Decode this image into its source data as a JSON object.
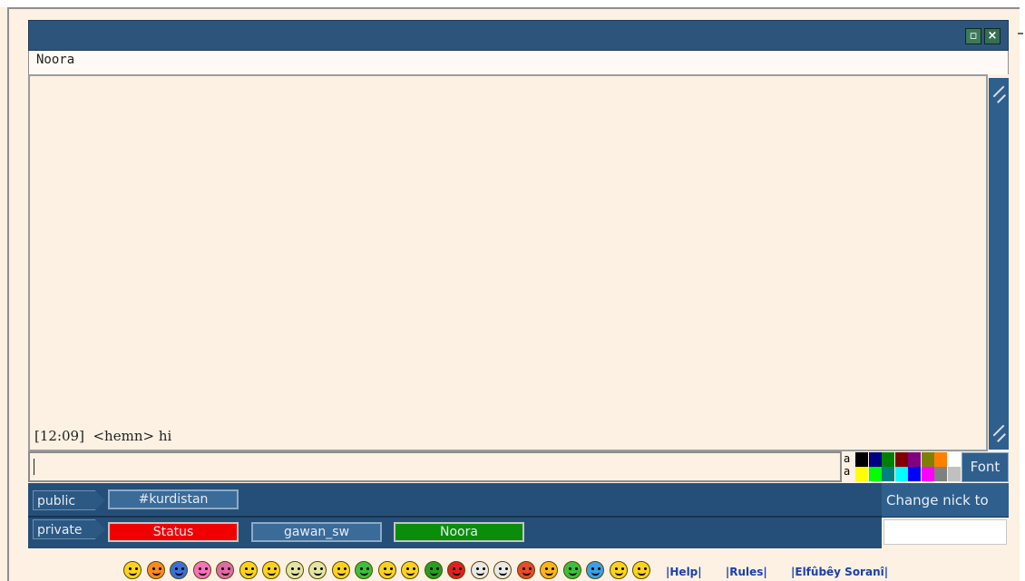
{
  "window": {
    "restore_icon": "restore-window-icon",
    "close_icon": "close-window-icon"
  },
  "nick_header": "Noora",
  "chat": {
    "messages": [
      {
        "time": "[12:09]",
        "nick": "<hemn>",
        "text": "hi"
      }
    ]
  },
  "input": {
    "value": "",
    "placeholder": ""
  },
  "color_palette": {
    "row1": [
      "#000000",
      "#000080",
      "#008000",
      "#800000",
      "#800080",
      "#808000",
      "#ff8000",
      "#ffffff"
    ],
    "row2": [
      "#ffff00",
      "#00ff00",
      "#008080",
      "#00ffff",
      "#0000ff",
      "#ff00ff",
      "#808080",
      "#c0c0c0"
    ]
  },
  "font_button": "Font",
  "channel_bar": {
    "public_label": "public",
    "private_label": "private",
    "public_tabs": [
      {
        "label": "#kurdistan",
        "color": "#3a6b99"
      }
    ],
    "private_tabs": [
      {
        "label": "Status",
        "color": "#f00000"
      },
      {
        "label": "gawan_sw",
        "color": "#3a6b99"
      },
      {
        "label": "Noora",
        "color": "#0a8d0a"
      }
    ]
  },
  "nick_change": {
    "button_label": "Change nick to",
    "input_value": ""
  },
  "smileys": [
    {
      "name": "smile-icon",
      "color": "#ffd21f"
    },
    {
      "name": "angry-icon",
      "color": "#ff8a1f"
    },
    {
      "name": "sad-blue-icon",
      "color": "#3b6fd8"
    },
    {
      "name": "shocked-icon",
      "color": "#ff70c0"
    },
    {
      "name": "tongue-icon",
      "color": "#e06aa8"
    },
    {
      "name": "confused-icon",
      "color": "#ffd21f"
    },
    {
      "name": "glasses-icon",
      "color": "#ffd21f"
    },
    {
      "name": "neutral-icon",
      "color": "#e4e4a4"
    },
    {
      "name": "frown-icon",
      "color": "#e4e4a4"
    },
    {
      "name": "wink-icon",
      "color": "#ffd21f"
    },
    {
      "name": "sick-icon",
      "color": "#3cbf3c"
    },
    {
      "name": "cowboy-icon",
      "color": "#ffd21f"
    },
    {
      "name": "grin-icon",
      "color": "#ffd21f"
    },
    {
      "name": "green-mad-icon",
      "color": "#22a022"
    },
    {
      "name": "red-mad-icon",
      "color": "#e02020"
    },
    {
      "name": "skull-icon",
      "color": "#e8e8e8"
    },
    {
      "name": "clown-icon",
      "color": "#e8e8e8"
    },
    {
      "name": "cool-icon",
      "color": "#e84a2a"
    },
    {
      "name": "laugh-icon",
      "color": "#ffb41f"
    },
    {
      "name": "alien-icon",
      "color": "#3cbf3c"
    },
    {
      "name": "cry-icon",
      "color": "#3aa0e8"
    },
    {
      "name": "sleepy-icon",
      "color": "#ffd21f"
    },
    {
      "name": "roll-eyes-icon",
      "color": "#ffd21f"
    }
  ],
  "links": [
    "|Help|",
    "|Rules|",
    "|Elfûbêy Soranî|"
  ]
}
